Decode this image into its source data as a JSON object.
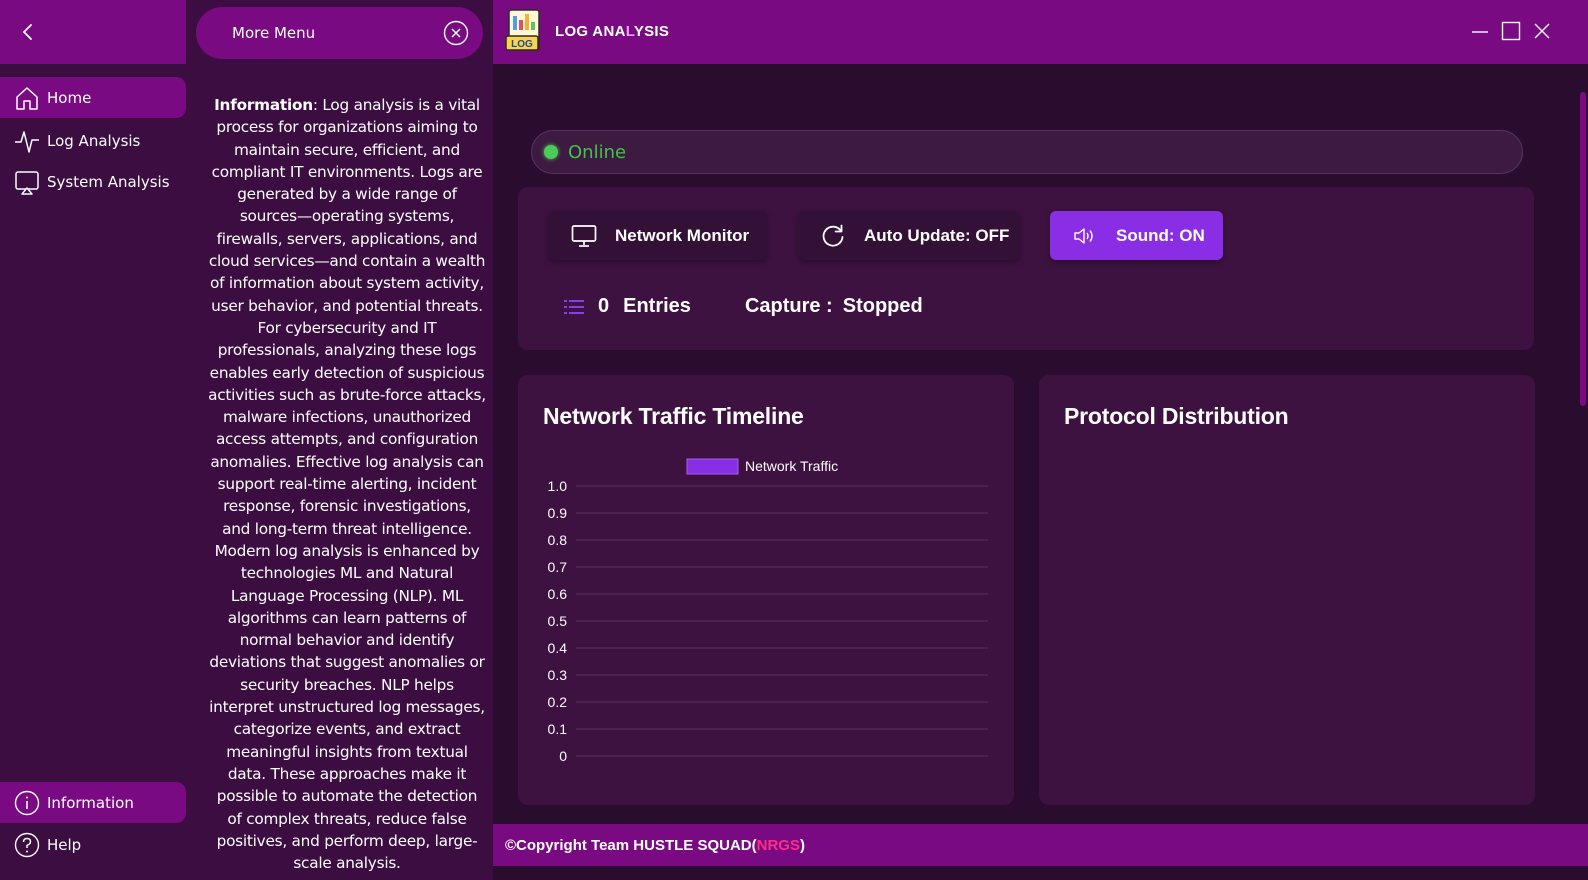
{
  "nav": {
    "items": [
      {
        "label": "Home",
        "icon": "home-icon"
      },
      {
        "label": "Log Analysis",
        "icon": "pulse-icon"
      },
      {
        "label": "System Analysis",
        "icon": "cast-icon"
      }
    ],
    "bottom_items": [
      {
        "label": "Information",
        "icon": "info-icon"
      },
      {
        "label": "Help",
        "icon": "help-icon"
      }
    ]
  },
  "more_menu": {
    "title": "More Menu",
    "info_heading": "Information",
    "info_body": ": Log analysis is a vital process for organizations aiming to maintain secure, efficient, and compliant IT environments. Logs are generated by a wide range of sources—operating systems, firewalls, servers, applications, and cloud services—and contain a wealth of information about system activity, user behavior, and potential threats. For cybersecurity and IT professionals, analyzing these logs enables early detection of suspicious activities such as brute-force attacks, malware infections, unauthorized access attempts, and configuration anomalies. Effective log analysis can support real-time alerting, incident response, forensic investigations, and long-term threat intelligence. Modern log analysis is enhanced by technologies ML and Natural Language Processing (NLP). ML algorithms can learn patterns of normal behavior and identify deviations that suggest anomalies or security breaches. NLP helps interpret unstructured log messages, categorize events, and extract meaningful insights from textual data. These approaches make it possible to automate the detection of complex threats, reduce false positives, and perform deep, large-scale analysis."
  },
  "app": {
    "title_part1": "LOG ANA",
    "title_part2": "L",
    "title_part3": "YSIS",
    "logo_text": "LOG"
  },
  "status": {
    "text": "Online",
    "color": "#43c14a"
  },
  "controls": {
    "network_monitor": "Network Monitor",
    "auto_update": "Auto Update: OFF",
    "sound": "Sound: ON",
    "entries_count": "0",
    "entries_label": "Entries",
    "capture_label": "Capture :",
    "capture_value": "Stopped"
  },
  "panels": {
    "traffic_title": "Network Traffic Timeline",
    "protocol_title": "Protocol Distribution"
  },
  "chart_data": {
    "type": "bar",
    "categories": [],
    "series": [
      {
        "name": "Network Traffic",
        "values": [],
        "color": "#8a2ee6"
      }
    ],
    "yticks": [
      "1.0",
      "0.9",
      "0.8",
      "0.7",
      "0.6",
      "0.5",
      "0.4",
      "0.3",
      "0.2",
      "0.1",
      "0"
    ],
    "ylim": [
      0,
      1.0
    ],
    "grid": true,
    "legend": "top"
  },
  "footer": {
    "prefix": "©Copyright Team HUSTLE SQUAD(",
    "accent": "NRGS",
    "suffix": ")"
  },
  "colors": {
    "accent": "#7a0a82",
    "sidebar": "#3b0d41",
    "background": "#2a0c2e",
    "button_active": "#8a2ee6",
    "footer_accent": "#ff2c8a"
  }
}
